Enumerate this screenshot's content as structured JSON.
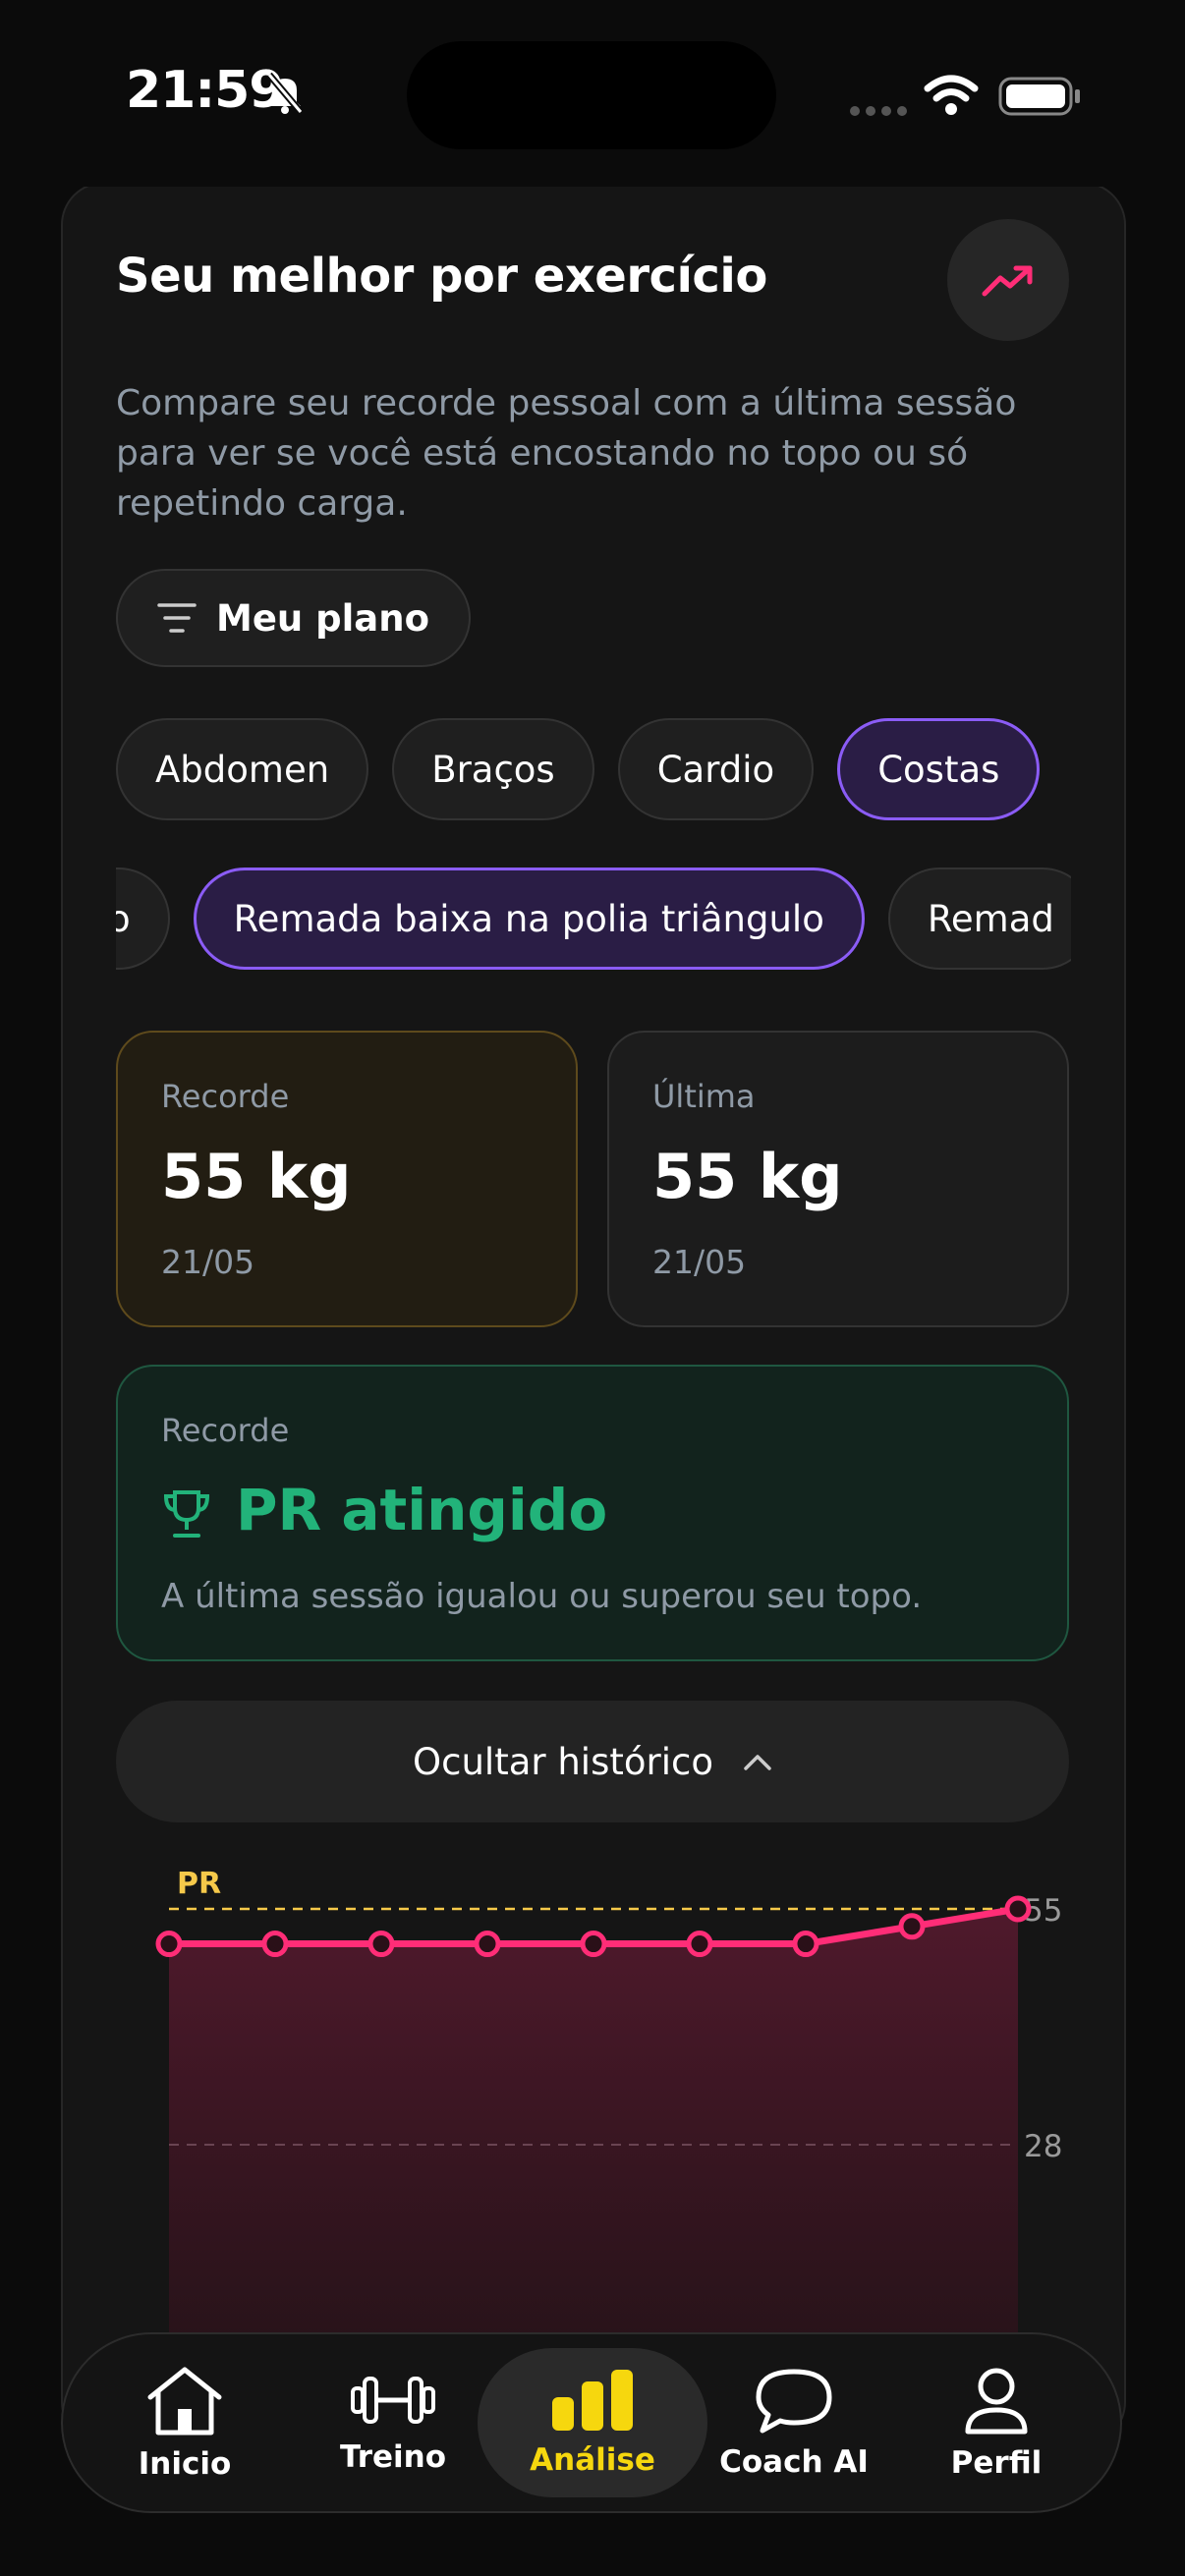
{
  "status": {
    "time": "21:59"
  },
  "card": {
    "title": "Seu melhor por exercício",
    "description": "Compare seu recorde pessoal com a última sessão para ver se você está encostando no topo ou só repetindo carga.",
    "plan_button": "Meu plano"
  },
  "muscle_groups": [
    "Abdomen",
    "Braços",
    "Cardio",
    "Costas"
  ],
  "selected_group": "Costas",
  "exercises": [
    "o",
    "Remada baixa na polia triângulo",
    "Remad"
  ],
  "selected_exercise": "Remada baixa na polia triângulo",
  "stats": {
    "record": {
      "label": "Recorde",
      "value": "55 kg",
      "date": "21/05"
    },
    "last": {
      "label": "Última",
      "value": "55 kg",
      "date": "21/05"
    }
  },
  "pr_box": {
    "label": "Recorde",
    "title": "PR atingido",
    "description": "A última sessão igualou ou superou seu topo."
  },
  "history_button": "Ocultar histórico",
  "chart_data": {
    "type": "area",
    "pr_line": {
      "label": "PR",
      "value": 55
    },
    "y_ticks": [
      55,
      28
    ],
    "ylim": [
      0,
      55
    ],
    "series": [
      {
        "values": [
          51,
          51,
          51,
          51,
          51,
          51,
          51,
          53,
          55
        ]
      }
    ],
    "colors": {
      "line": "#ff2d77",
      "pr": "#f6c94a"
    }
  },
  "nav": {
    "items": [
      {
        "label": "Inicio",
        "icon": "home-icon"
      },
      {
        "label": "Treino",
        "icon": "dumbbell-icon"
      },
      {
        "label": "Análise",
        "icon": "bar-chart-icon"
      },
      {
        "label": "Coach AI",
        "icon": "chat-icon"
      },
      {
        "label": "Perfil",
        "icon": "user-icon"
      }
    ],
    "active": "Análise"
  },
  "colors": {
    "accent_purple": "#8b5cf6",
    "accent_green": "#22b37a",
    "accent_yellow": "#f6d70e",
    "accent_pink": "#ff2d77"
  }
}
